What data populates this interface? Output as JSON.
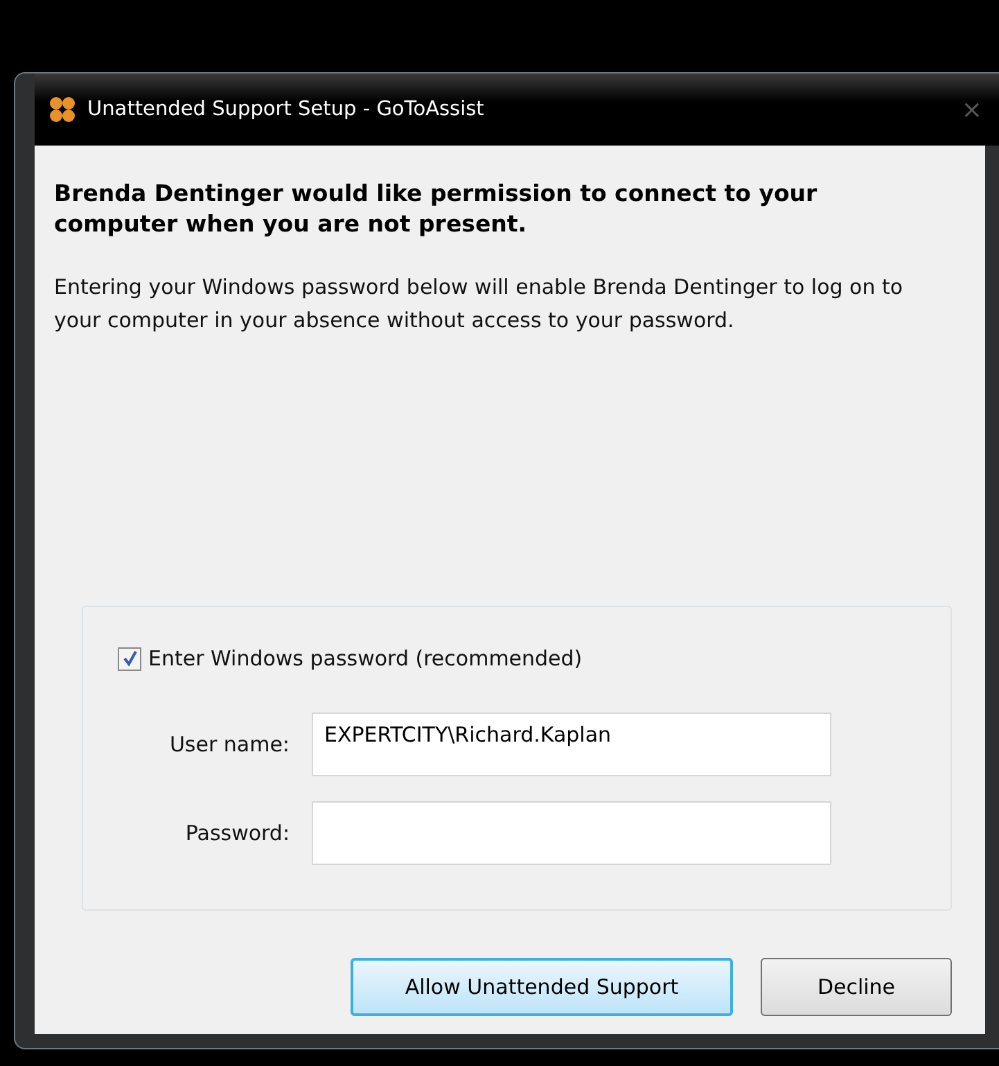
{
  "window": {
    "title": "Unattended Support Setup - GoToAssist",
    "close": "×"
  },
  "heading": "Brenda Dentinger would like permission to connect to your computer when you are not present.",
  "description": "Entering your Windows password below will enable Brenda Dentinger to log on to your computer in your absence without access to your password.",
  "checkbox": {
    "label": "Enter Windows password (recommended)",
    "checked": true
  },
  "fields": [
    {
      "label": "User name:",
      "value": "EXPERTCITY\\Richard.Kaplan"
    },
    {
      "label": "Password:"
    }
  ],
  "buttons": [
    {
      "label": "Allow Unattended Support",
      "default": true
    },
    {
      "label": "Decline",
      "default": false
    }
  ]
}
